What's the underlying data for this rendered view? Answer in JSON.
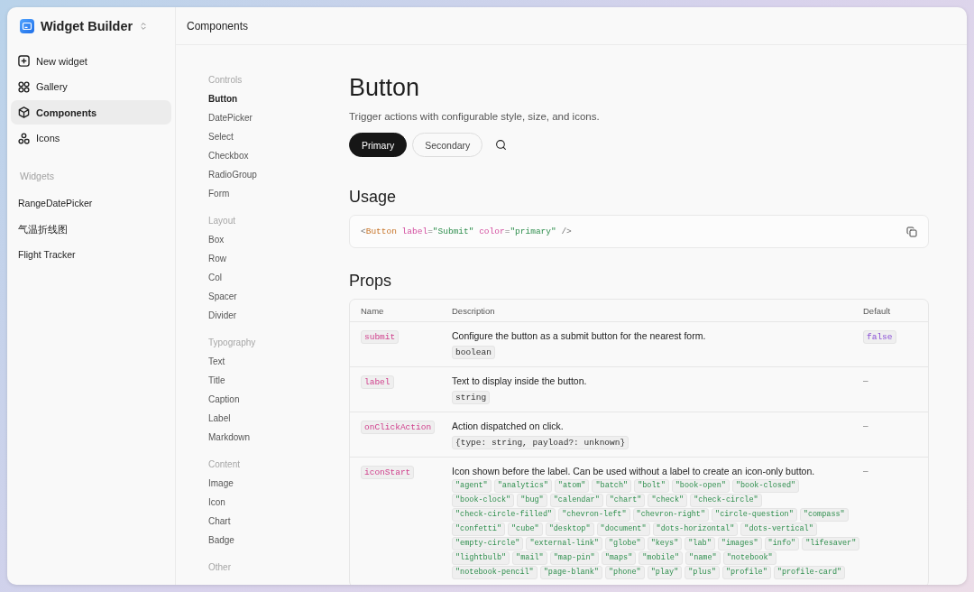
{
  "app": {
    "title": "Widget Builder"
  },
  "nav": [
    {
      "label": "New widget",
      "selected": false
    },
    {
      "label": "Gallery",
      "selected": false
    },
    {
      "label": "Components",
      "selected": true
    },
    {
      "label": "Icons",
      "selected": false
    }
  ],
  "widgets": {
    "heading": "Widgets",
    "items": [
      "RangeDatePicker",
      "气温折线图",
      "Flight Tracker"
    ]
  },
  "header": {
    "title": "Components"
  },
  "component_nav": [
    {
      "heading": "Controls",
      "items": [
        {
          "label": "Button",
          "selected": true
        },
        {
          "label": "DatePicker",
          "selected": false
        },
        {
          "label": "Select",
          "selected": false
        },
        {
          "label": "Checkbox",
          "selected": false
        },
        {
          "label": "RadioGroup",
          "selected": false
        },
        {
          "label": "Form",
          "selected": false
        }
      ]
    },
    {
      "heading": "Layout",
      "items": [
        {
          "label": "Box",
          "selected": false
        },
        {
          "label": "Row",
          "selected": false
        },
        {
          "label": "Col",
          "selected": false
        },
        {
          "label": "Spacer",
          "selected": false
        },
        {
          "label": "Divider",
          "selected": false
        }
      ]
    },
    {
      "heading": "Typography",
      "items": [
        {
          "label": "Text",
          "selected": false
        },
        {
          "label": "Title",
          "selected": false
        },
        {
          "label": "Caption",
          "selected": false
        },
        {
          "label": "Label",
          "selected": false
        },
        {
          "label": "Markdown",
          "selected": false
        }
      ]
    },
    {
      "heading": "Content",
      "items": [
        {
          "label": "Image",
          "selected": false
        },
        {
          "label": "Icon",
          "selected": false
        },
        {
          "label": "Chart",
          "selected": false
        },
        {
          "label": "Badge",
          "selected": false
        }
      ]
    },
    {
      "heading": "Other"
    }
  ],
  "page": {
    "title": "Button",
    "description": "Trigger actions with configurable style, size, and icons.",
    "demo_buttons": [
      {
        "label": "Primary",
        "kind": "primary"
      },
      {
        "label": "Secondary",
        "kind": "secondary"
      },
      {
        "kind": "icon"
      }
    ]
  },
  "usage": {
    "heading": "Usage",
    "code": [
      {
        "kind": "punct",
        "text": "<"
      },
      {
        "kind": "tag",
        "text": "Button"
      },
      {
        "kind": "attr",
        "text": " label"
      },
      {
        "kind": "punct",
        "text": "="
      },
      {
        "kind": "string",
        "text": "\"Submit\""
      },
      {
        "kind": "attr",
        "text": " color"
      },
      {
        "kind": "punct",
        "text": "="
      },
      {
        "kind": "string",
        "text": "\"primary\""
      },
      {
        "kind": "punct",
        "text": " />"
      }
    ]
  },
  "props": {
    "heading": "Props",
    "columns": [
      "Name",
      "Description",
      "Default"
    ],
    "rows": [
      {
        "name": "submit",
        "description": "Configure the button as a submit button for the nearest form.",
        "type": "boolean",
        "default": {
          "kind": "code",
          "text": "false"
        }
      },
      {
        "name": "label",
        "description": "Text to display inside the button.",
        "type": "string",
        "default": {
          "kind": "plain",
          "text": "–"
        }
      },
      {
        "name": "onClickAction",
        "description": "Action dispatched on click.",
        "type": "{type: string, payload?: unknown}",
        "default": {
          "kind": "plain",
          "text": "–"
        }
      },
      {
        "name": "iconStart",
        "description": "Icon shown before the label. Can be used without a label to create an icon-only button.",
        "values": [
          "\"agent\"",
          "\"analytics\"",
          "\"atom\"",
          "\"batch\"",
          "\"bolt\"",
          "\"book-open\"",
          "\"book-closed\"",
          "\"book-clock\"",
          "\"bug\"",
          "\"calendar\"",
          "\"chart\"",
          "\"check\"",
          "\"check-circle\"",
          "\"check-circle-filled\"",
          "\"chevron-left\"",
          "\"chevron-right\"",
          "\"circle-question\"",
          "\"compass\"",
          "\"confetti\"",
          "\"cube\"",
          "\"desktop\"",
          "\"document\"",
          "\"dots-horizontal\"",
          "\"dots-vertical\"",
          "\"empty-circle\"",
          "\"external-link\"",
          "\"globe\"",
          "\"keys\"",
          "\"lab\"",
          "\"images\"",
          "\"info\"",
          "\"lifesaver\"",
          "\"lightbulb\"",
          "\"mail\"",
          "\"map-pin\"",
          "\"maps\"",
          "\"mobile\"",
          "\"name\"",
          "\"notebook\"",
          "\"notebook-pencil\"",
          "\"page-blank\"",
          "\"phone\"",
          "\"play\"",
          "\"plus\"",
          "\"profile\"",
          "\"profile-card\""
        ],
        "default": {
          "kind": "plain",
          "text": "–"
        }
      }
    ]
  }
}
